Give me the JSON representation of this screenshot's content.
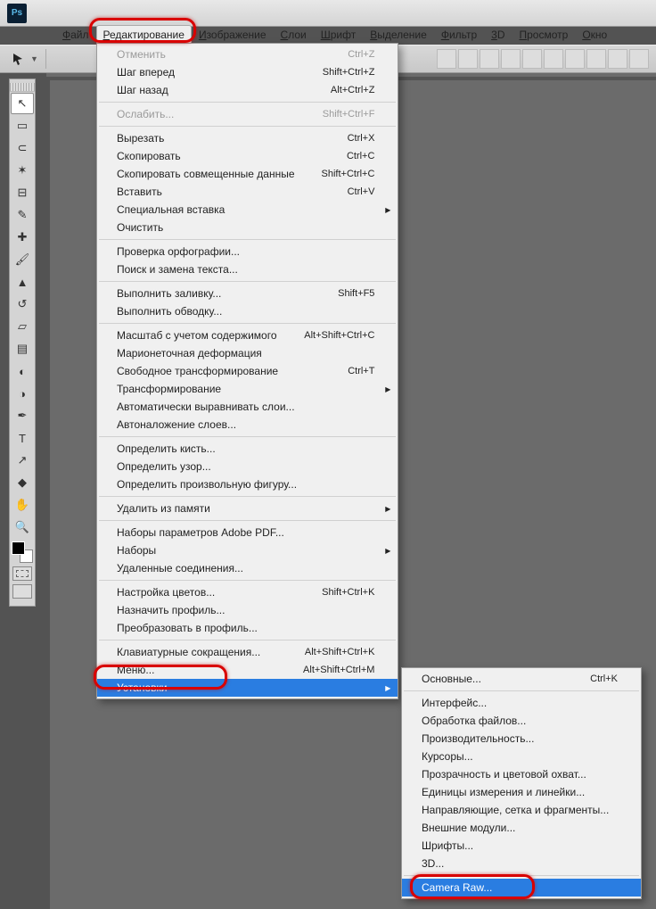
{
  "logo": "Ps",
  "menubar": [
    "Файл",
    "Редактирование",
    "Изображение",
    "Слои",
    "Шрифт",
    "Выделение",
    "Фильтр",
    "3D",
    "Просмотр",
    "Окно"
  ],
  "editMenu": [
    {
      "t": "item",
      "label": "Отменить",
      "sc": "Ctrl+Z",
      "disabled": true
    },
    {
      "t": "item",
      "label": "Шаг вперед",
      "sc": "Shift+Ctrl+Z"
    },
    {
      "t": "item",
      "label": "Шаг назад",
      "sc": "Alt+Ctrl+Z"
    },
    {
      "t": "sep"
    },
    {
      "t": "item",
      "label": "Ослабить...",
      "sc": "Shift+Ctrl+F",
      "disabled": true
    },
    {
      "t": "sep"
    },
    {
      "t": "item",
      "label": "Вырезать",
      "sc": "Ctrl+X"
    },
    {
      "t": "item",
      "label": "Скопировать",
      "sc": "Ctrl+C"
    },
    {
      "t": "item",
      "label": "Скопировать совмещенные данные",
      "sc": "Shift+Ctrl+C"
    },
    {
      "t": "item",
      "label": "Вставить",
      "sc": "Ctrl+V"
    },
    {
      "t": "item",
      "label": "Специальная вставка",
      "arrow": true
    },
    {
      "t": "item",
      "label": "Очистить"
    },
    {
      "t": "sep"
    },
    {
      "t": "item",
      "label": "Проверка орфографии..."
    },
    {
      "t": "item",
      "label": "Поиск и замена текста..."
    },
    {
      "t": "sep"
    },
    {
      "t": "item",
      "label": "Выполнить заливку...",
      "sc": "Shift+F5"
    },
    {
      "t": "item",
      "label": "Выполнить обводку..."
    },
    {
      "t": "sep"
    },
    {
      "t": "item",
      "label": "Масштаб с учетом содержимого",
      "sc": "Alt+Shift+Ctrl+C"
    },
    {
      "t": "item",
      "label": "Марионеточная деформация"
    },
    {
      "t": "item",
      "label": "Свободное трансформирование",
      "sc": "Ctrl+T"
    },
    {
      "t": "item",
      "label": "Трансформирование",
      "arrow": true
    },
    {
      "t": "item",
      "label": "Автоматически выравнивать слои..."
    },
    {
      "t": "item",
      "label": "Автоналожение слоев..."
    },
    {
      "t": "sep"
    },
    {
      "t": "item",
      "label": "Определить кисть..."
    },
    {
      "t": "item",
      "label": "Определить узор..."
    },
    {
      "t": "item",
      "label": "Определить произвольную фигуру..."
    },
    {
      "t": "sep"
    },
    {
      "t": "item",
      "label": "Удалить из памяти",
      "arrow": true
    },
    {
      "t": "sep"
    },
    {
      "t": "item",
      "label": "Наборы параметров Adobe PDF..."
    },
    {
      "t": "item",
      "label": "Наборы",
      "arrow": true
    },
    {
      "t": "item",
      "label": "Удаленные соединения..."
    },
    {
      "t": "sep"
    },
    {
      "t": "item",
      "label": "Настройка цветов...",
      "sc": "Shift+Ctrl+K"
    },
    {
      "t": "item",
      "label": "Назначить профиль..."
    },
    {
      "t": "item",
      "label": "Преобразовать в профиль..."
    },
    {
      "t": "sep"
    },
    {
      "t": "item",
      "label": "Клавиатурные сокращения...",
      "sc": "Alt+Shift+Ctrl+K"
    },
    {
      "t": "item",
      "label": "Меню...",
      "sc": "Alt+Shift+Ctrl+M"
    },
    {
      "t": "item",
      "label": "Установки",
      "arrow": true,
      "hl": true
    }
  ],
  "prefsMenu": [
    {
      "t": "item",
      "label": "Основные...",
      "sc": "Ctrl+K"
    },
    {
      "t": "sep"
    },
    {
      "t": "item",
      "label": "Интерфейс..."
    },
    {
      "t": "item",
      "label": "Обработка файлов..."
    },
    {
      "t": "item",
      "label": "Производительность..."
    },
    {
      "t": "item",
      "label": "Курсоры..."
    },
    {
      "t": "item",
      "label": "Прозрачность и цветовой охват..."
    },
    {
      "t": "item",
      "label": "Единицы измерения и линейки..."
    },
    {
      "t": "item",
      "label": "Направляющие, сетка и фрагменты..."
    },
    {
      "t": "item",
      "label": "Внешние модули..."
    },
    {
      "t": "item",
      "label": "Шрифты..."
    },
    {
      "t": "item",
      "label": "3D..."
    },
    {
      "t": "sep"
    },
    {
      "t": "item",
      "label": "Camera Raw...",
      "hl": true
    }
  ],
  "tools": [
    "move",
    "marquee",
    "lasso",
    "wand",
    "crop",
    "eyedrop",
    "heal",
    "brush",
    "stamp",
    "history",
    "eraser",
    "gradient",
    "blur",
    "dodge",
    "pen",
    "type",
    "path",
    "shape",
    "hand",
    "zoom"
  ]
}
